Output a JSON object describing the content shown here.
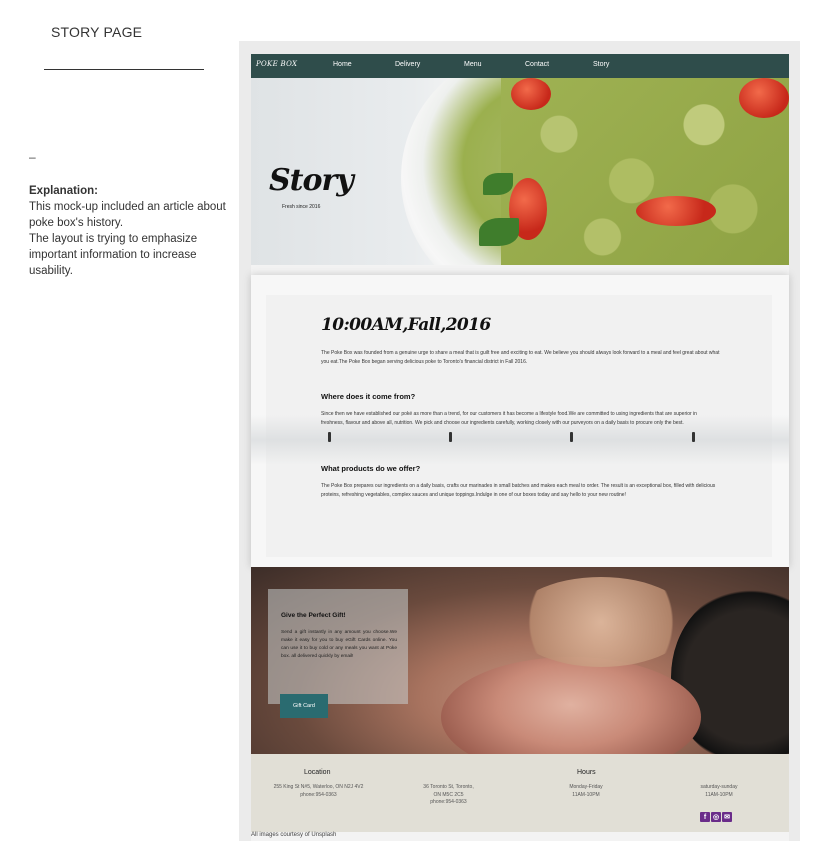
{
  "annotation": {
    "page_title": "STORY PAGE",
    "dash": "–",
    "explanation_heading": "Explanation:",
    "explanation_lines": [
      "This mock-up included an article about",
      "poke box's history.",
      "The layout is trying to emphasize",
      "important information to increase",
      "usability."
    ]
  },
  "nav": {
    "logo": "POKE BOX",
    "links": [
      "Home",
      "Delivery",
      "Menu",
      "Contact",
      "Story"
    ]
  },
  "hero": {
    "title": "Story",
    "subtitle": "Fresh since 2016"
  },
  "article": {
    "title": "10:00AM,Fall,2016",
    "intro": "The Poke Box was founded from a genuine urge to share a meal that is guilt free and exciting to eat. We believe you should always look forward to a meal and feel great about what you eat.The Poke Box began serving delicious poke to Toronto's financial district in Fall 2016.",
    "section1_heading": "Where does it come from?",
    "section1_text": "Since then we have established our poké as more than a trend, for our customers it has become a lifestyle food.We are committed to using ingredients that are superior in freshness, flavour and above all, nutrition. We pick and choose our ingredients carefully, working closely with our purveyors on a daily basis to procure only the best.",
    "section2_heading": "What products do we offer?",
    "section2_text": "The Poke Box prepares our ingredients on a daily basis, crafts our marinades in small batches and makes each meal to order. The result is an exceptional box, filled with delicious proteins, refreshing vegetables, complex sauces and unique toppings.Indulge in one of our boxes today and say hello to your new routine!"
  },
  "gift": {
    "title": "Give the Perfect Gift!",
    "text": "Send a gift instantly in any amount you choose.We make it easy for you to buy eGift Cards online. You can use it to buy cold or any meals you want at Poke box. all delivered quickly by email!",
    "button": "Gift Card"
  },
  "footer": {
    "location_heading": "Location",
    "location1": [
      "255 King St N#5, Waterloo, ON N2J 4V2",
      "phone:954-0363"
    ],
    "location2": [
      "36 Toronto St, Toronto,",
      "ON M5C 2C5",
      "phone:954-0363"
    ],
    "hours_heading": "Hours",
    "hours_weekday": [
      "Monday-Friday",
      "11AM-10PM"
    ],
    "hours_weekend": [
      "saturday-sunday",
      "11AM-10PM"
    ],
    "social_icons": [
      "facebook-icon",
      "instagram-icon",
      "mail-icon"
    ]
  },
  "credit": "All images courtesy of Unsplash",
  "colors": {
    "nav_bg": "#2f4d4b",
    "button_bg": "#2a6b70",
    "footer_bg": "#e1dfd6",
    "social": "#6a2c8a"
  }
}
